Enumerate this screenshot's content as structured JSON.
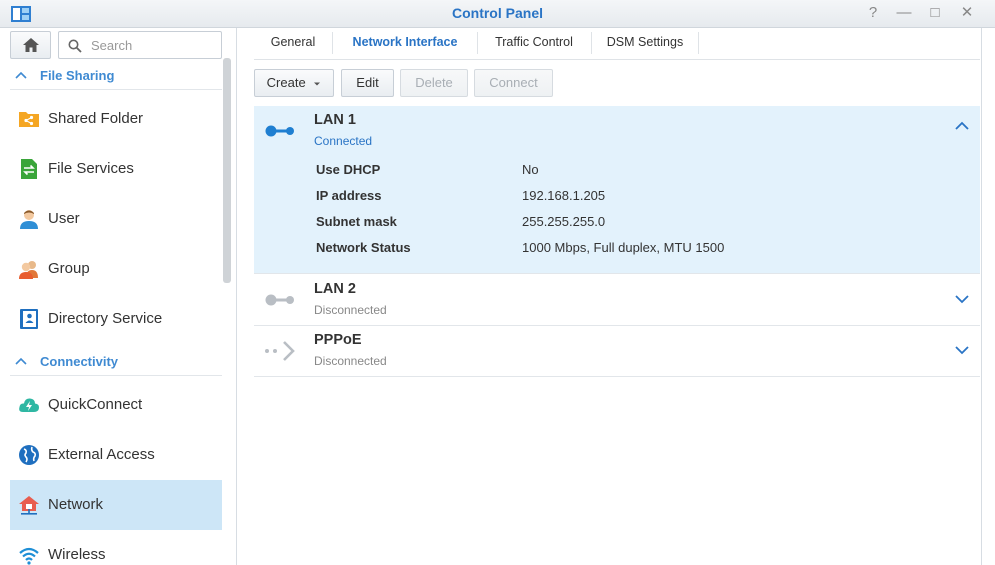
{
  "window": {
    "title": "Control Panel",
    "controls": [
      "?",
      "—",
      "□",
      "✕"
    ]
  },
  "sidebar": {
    "search_placeholder": "Search",
    "sections": [
      {
        "label": "File Sharing"
      },
      {
        "label": "Connectivity"
      }
    ],
    "items": [
      {
        "label": "Shared Folder",
        "icon": "shared-folder-icon"
      },
      {
        "label": "File Services",
        "icon": "file-services-icon"
      },
      {
        "label": "User",
        "icon": "user-icon"
      },
      {
        "label": "Group",
        "icon": "group-icon"
      },
      {
        "label": "Directory Service",
        "icon": "directory-service-icon"
      },
      {
        "label": "QuickConnect",
        "icon": "quickconnect-icon"
      },
      {
        "label": "External Access",
        "icon": "external-access-icon"
      },
      {
        "label": "Network",
        "icon": "network-icon",
        "active": true
      },
      {
        "label": "Wireless",
        "icon": "wireless-icon"
      }
    ]
  },
  "tabs": [
    {
      "label": "General"
    },
    {
      "label": "Network Interface",
      "active": true
    },
    {
      "label": "Traffic Control"
    },
    {
      "label": "DSM Settings"
    }
  ],
  "toolbar": {
    "create": "Create",
    "edit": "Edit",
    "delete": "Delete",
    "connect": "Connect"
  },
  "interfaces": [
    {
      "name": "LAN 1",
      "status": "Connected",
      "expanded": true,
      "details": [
        {
          "key": "Use DHCP",
          "value": "No"
        },
        {
          "key": "IP address",
          "value": "192.168.1.205"
        },
        {
          "key": "Subnet mask",
          "value": "255.255.255.0"
        },
        {
          "key": "Network Status",
          "value": "1000 Mbps, Full duplex, MTU 1500"
        }
      ]
    },
    {
      "name": "LAN 2",
      "status": "Disconnected",
      "expanded": false
    },
    {
      "name": "PPPoE",
      "status": "Disconnected",
      "expanded": false
    }
  ],
  "colors": {
    "accent": "#2a74c5",
    "section_heading": "#3f8ad2",
    "active_nav_bg": "#cde6f7",
    "expanded_row_bg": "#e3f2fc"
  }
}
